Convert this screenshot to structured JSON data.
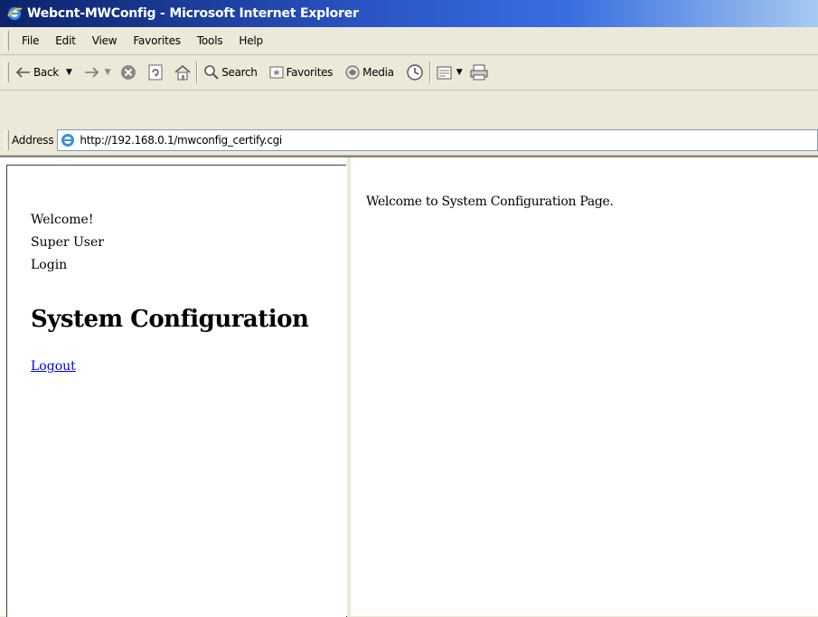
{
  "window": {
    "title": "Webcnt-MWConfig - Microsoft Internet Explorer",
    "icon": "ie-icon"
  },
  "menubar": {
    "items": [
      "File",
      "Edit",
      "View",
      "Favorites",
      "Tools",
      "Help"
    ]
  },
  "toolbar": {
    "back_label": "Back",
    "search_label": "Search",
    "favorites_label": "Favorites",
    "media_label": "Media"
  },
  "addressbar": {
    "label": "Address",
    "url": "http://192.168.0.1/mwconfig_certify.cgi"
  },
  "left_frame": {
    "welcome": "Welcome!",
    "user": "Super User",
    "login": "Login",
    "heading": "System Configuration",
    "logout_link": "Logout"
  },
  "right_frame": {
    "message": "Welcome to System Configuration Page."
  },
  "colors": {
    "titlebar_start": "#0a246a",
    "titlebar_end": "#a6caf0",
    "chrome_bg": "#ece9d8",
    "link": "#0000ee"
  }
}
